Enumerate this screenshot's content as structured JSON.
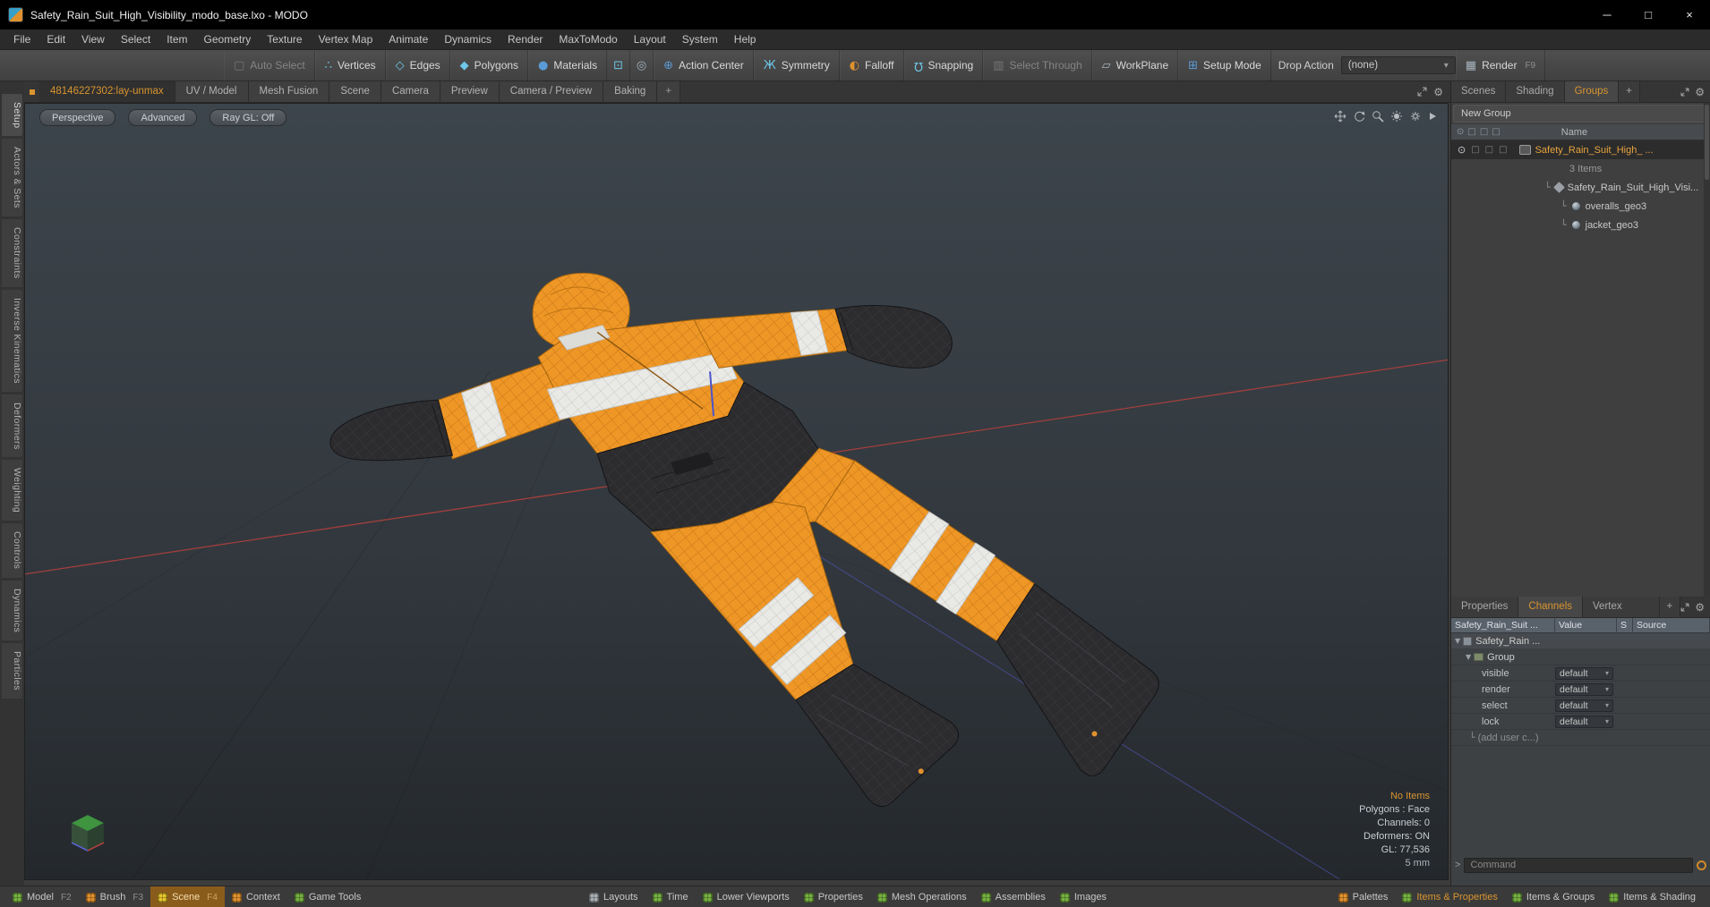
{
  "title_bar": {
    "title": "Safety_Rain_Suit_High_Visibility_modo_base.lxo - MODO",
    "minimize": "─",
    "maximize": "□",
    "close": "×"
  },
  "menu_bar": {
    "items": [
      "File",
      "Edit",
      "View",
      "Select",
      "Item",
      "Geometry",
      "Texture",
      "Vertex Map",
      "Animate",
      "Dynamics",
      "Render",
      "MaxToModo",
      "Layout",
      "System",
      "Help"
    ]
  },
  "toolbar": {
    "buttons": [
      {
        "label": "Auto Select",
        "icon": "▢"
      },
      {
        "label": "Vertices",
        "icon": "∴"
      },
      {
        "label": "Edges",
        "icon": "◇"
      },
      {
        "label": "Polygons",
        "icon": "◆"
      },
      {
        "label": "Materials",
        "icon": "●"
      },
      {
        "label": "Action Center",
        "icon": "⊕"
      },
      {
        "label": "Symmetry",
        "icon": "Ж"
      },
      {
        "label": "Falloff",
        "icon": "◐"
      },
      {
        "label": "Snapping",
        "icon": "Ω"
      },
      {
        "label": "Select Through",
        "icon": "▥"
      },
      {
        "label": "WorkPlane",
        "icon": "▱"
      },
      {
        "label": "Setup Mode",
        "icon": "⊞"
      }
    ],
    "item_mode_icon": "⊡",
    "center_mode_icon": "◎",
    "drop_action_label": "Drop Action",
    "drop_action_value": "(none)",
    "render_label": "Render",
    "render_icon": "▦",
    "render_key": "F9"
  },
  "tab_bar": {
    "tabs": [
      "48146227302:lay-unmax",
      "UV / Model",
      "Mesh Fusion",
      "Scene",
      "Camera",
      "Preview",
      "Camera / Preview",
      "Baking"
    ],
    "add": "+"
  },
  "left_tabs": [
    "Setup",
    "Actors & Sets",
    "Constraints",
    "Inverse Kinematics",
    "Deformers",
    "Weighting",
    "Controls",
    "Dynamics",
    "Particles"
  ],
  "viewport": {
    "mode_buttons": [
      "Perspective",
      "Advanced",
      "Ray GL: Off"
    ],
    "info_lines": [
      "No Items",
      "Polygons : Face",
      "Channels: 0",
      "Deformers: ON",
      "GL: 77,536",
      "5 mm"
    ]
  },
  "groups_panel": {
    "tabs": [
      "Scenes",
      "Shading",
      "Groups"
    ],
    "add": "+",
    "new_group_label": "New Group",
    "name_header": "Name",
    "rows": [
      {
        "label": "Safety_Rain_Suit_High_ ..."
      },
      {
        "label": "3 Items"
      },
      {
        "label": "Safety_Rain_Suit_High_Visi..."
      },
      {
        "label": "overalls_geo3"
      },
      {
        "label": "jacket_geo3"
      }
    ]
  },
  "channels_panel": {
    "tabs": [
      "Properties",
      "Channels",
      "Vertex Maps"
    ],
    "add": "+",
    "columns": [
      "Safety_Rain_Suit ...",
      "Value",
      "S",
      "Source"
    ],
    "rows": [
      {
        "name": "Safety_Rain ..."
      },
      {
        "name": "Group"
      },
      {
        "name": "visible",
        "value": "default"
      },
      {
        "name": "render",
        "value": "default"
      },
      {
        "name": "select",
        "value": "default"
      },
      {
        "name": "lock",
        "value": "default"
      },
      {
        "name": "(add user c...)"
      }
    ],
    "command_placeholder": "Command"
  },
  "bottom_bar": {
    "left": [
      {
        "label": "Model",
        "key": "F2"
      },
      {
        "label": "Brush",
        "key": "F3"
      },
      {
        "label": "Scene",
        "key": "F4"
      },
      {
        "label": "Context",
        "key": ""
      },
      {
        "label": "Game Tools",
        "key": ""
      }
    ],
    "center": [
      {
        "label": "Layouts"
      },
      {
        "label": "Time"
      },
      {
        "label": "Lower Viewports"
      },
      {
        "label": "Properties"
      },
      {
        "label": "Mesh Operations"
      },
      {
        "label": "Assemblies"
      },
      {
        "label": "Images"
      }
    ],
    "right": [
      {
        "label": "Palettes"
      },
      {
        "label": "Items & Properties"
      },
      {
        "label": "Items & Groups"
      },
      {
        "label": "Items & Shading"
      }
    ]
  },
  "icons": {
    "dropdown_arrow": "▾",
    "expand": "▼",
    "branch": "└",
    "eye": "⊙",
    "box": "□",
    "gear": "⚙"
  },
  "colors": {
    "accent": "#d9952f",
    "suit_orange": "#ef9726",
    "suit_black": "#2c2c2f",
    "stripe_white": "#e9e9e6",
    "axis_red": "#b5413c",
    "axis_blue": "#5a64dc"
  }
}
